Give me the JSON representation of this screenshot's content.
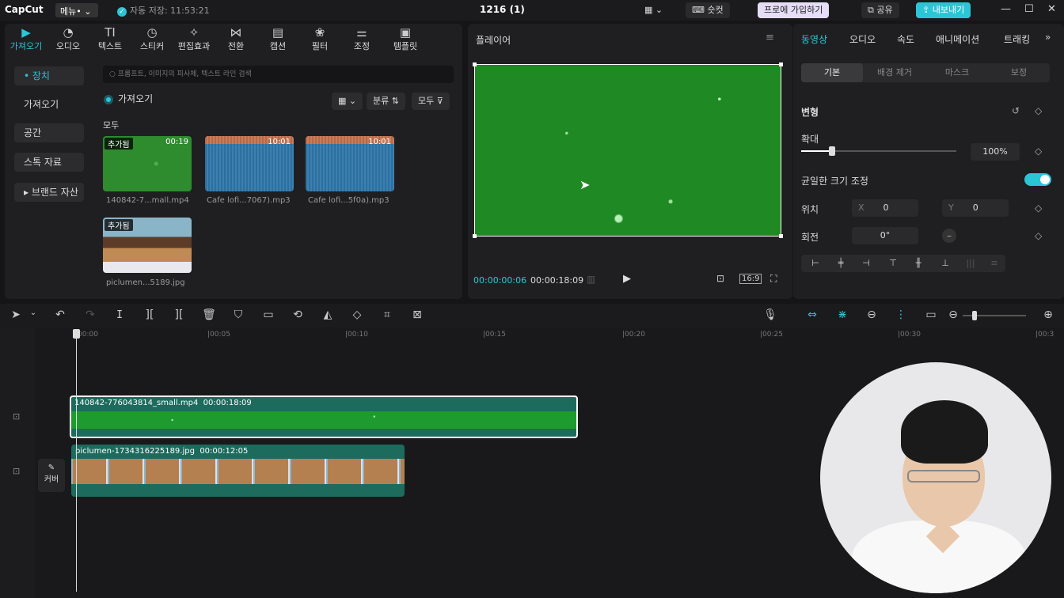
{
  "titlebar": {
    "logo": "CapCut",
    "menu": "메뉴•",
    "autosave": "자동 저장: 11:53:21",
    "project": "1216 (1)",
    "shortcut": "숏컷",
    "pro": "프로에 가입하기",
    "share": "공유",
    "export": "내보내기"
  },
  "tools": [
    "가져오기",
    "오디오",
    "텍스트",
    "스티커",
    "편집효과",
    "전환",
    "캡션",
    "필터",
    "조정",
    "템플릿"
  ],
  "side": [
    "• 장치",
    "가져오기",
    "공간",
    "스톡 자료",
    "▸ 브랜드 자산"
  ],
  "media": {
    "search_placeholder": "프롬프트, 이미지의 피사체, 텍스트 라인 검색",
    "import": "가져오기",
    "sort": "분류",
    "filter": "모두",
    "all": "모두",
    "items": [
      {
        "badge": "추가됨",
        "dur": "00:19",
        "name": "140842-7...mall.mp4"
      },
      {
        "badge": "",
        "dur": "10:01",
        "name": "Cafe lofi...7067).mp3"
      },
      {
        "badge": "",
        "dur": "10:01",
        "name": "Cafe lofi...5f0a).mp3"
      },
      {
        "badge": "추가됨",
        "dur": "",
        "name": "piclumen...5189.jpg"
      }
    ]
  },
  "player": {
    "title": "플레이어",
    "current": "00:00:00:06",
    "total": "00:00:18:09",
    "ratio": "16:9"
  },
  "rightpanel": {
    "tabs": [
      "동영상",
      "오디오",
      "속도",
      "애니메이션",
      "트래킹"
    ],
    "subtabs": [
      "기본",
      "배경 제거",
      "마스크",
      "보정"
    ],
    "transform": "변형",
    "scale": "확대",
    "scale_value": "100%",
    "scale_fraction": 0.2,
    "uniform": "균일한 크기 조정",
    "position": "위치",
    "x_label": "X",
    "x": "0",
    "y_label": "Y",
    "y": "0",
    "rotation": "회전",
    "rotation_value": "0°"
  },
  "timeline": {
    "ruler": [
      "00:00",
      "|00:05",
      "|00:10",
      "|00:15",
      "|00:20",
      "|00:25",
      "|00:30",
      "|00:3"
    ],
    "clip_video": {
      "name": "140842-776043814_small.mp4",
      "dur": "00:00:18:09"
    },
    "clip_photo": {
      "name": "piclumen-1734316225189.jpg",
      "dur": "00:00:12:05"
    },
    "cover": "커버"
  }
}
